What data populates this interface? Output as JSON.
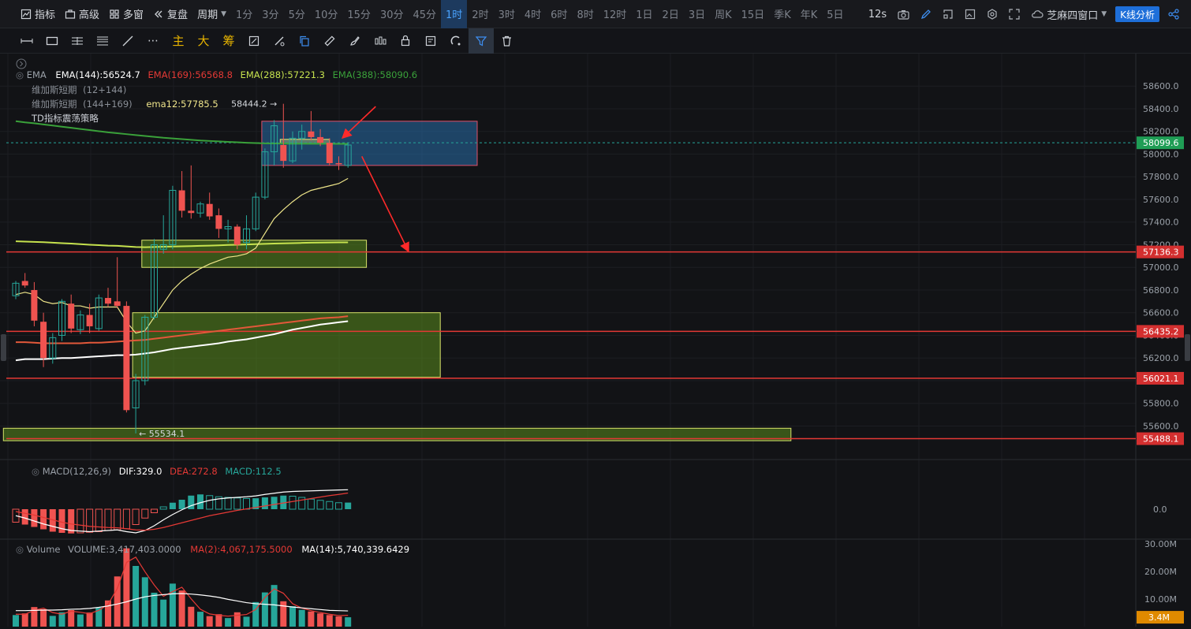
{
  "toolbar": {
    "indicators_label": "指标",
    "advanced_label": "高级",
    "multiwindow_label": "多窗",
    "replay_label": "复盘",
    "period_label": "周期",
    "periods": [
      "1分",
      "3分",
      "5分",
      "10分",
      "15分",
      "30分",
      "45分",
      "1时",
      "2时",
      "3时",
      "4时",
      "6时",
      "8时",
      "12时",
      "1日",
      "2日",
      "3日",
      "周K",
      "15日",
      "季K",
      "年K",
      "5日"
    ],
    "active_period": "1时",
    "refresh_label": "12s",
    "window_label": "芝麻四窗口",
    "kline_analysis_label": "K线分析"
  },
  "drawing_tools": {
    "main_label": "主",
    "big_label": "大",
    "chip_label": "筹"
  },
  "main_legend": {
    "name": "EMA",
    "ema144": "EMA(144):56524.7",
    "ema169": "EMA(169):56568.8",
    "ema288": "EMA(288):57221.3",
    "ema388": "EMA(388):58090.6",
    "vegas_short": "维加斯短期",
    "vegas_short_param": "(12+144)",
    "vegas_short2": "维加斯短期",
    "vegas_short2_param": "(144+169)",
    "ema12": "ema12:57785.5",
    "td_strategy": "TD指标震荡策略"
  },
  "price_axis": {
    "ticks": [
      "58600.0",
      "58400.0",
      "58200.0",
      "58000.0",
      "57800.0",
      "57600.0",
      "57400.0",
      "57200.0",
      "57000.0",
      "56800.0",
      "56600.0",
      "56400.0",
      "56200.0",
      "56000.0",
      "55800.0",
      "55600.0"
    ],
    "current_price": "58099.6",
    "levels": [
      "57136.3",
      "56435.2",
      "56021.1",
      "55488.1"
    ]
  },
  "annotations": {
    "high": "58444.2",
    "low": "55534.1"
  },
  "macd": {
    "name": "MACD(12,26,9)",
    "dif": "DIF:329.0",
    "dea": "DEA:272.8",
    "macd": "MACD:112.5",
    "axis_zero": "0.0"
  },
  "volume": {
    "name": "Volume",
    "volume": "VOLUME:3,417,403.0000",
    "ma2": "MA(2):4,067,175.5000",
    "ma14": "MA(14):5,740,339.6429",
    "ticks": [
      "30.00M",
      "20.00M",
      "10.00M"
    ],
    "current": "3.4M"
  },
  "colors": {
    "up": "#26a69a",
    "down": "#ef5350",
    "accent": "#1e6fd9",
    "level_line": "#e53935",
    "current_price": "#1f9d55",
    "current_volume": "#e08a00"
  },
  "chart_data": {
    "type": "candlestick",
    "interval": "1时",
    "ylim": [
      55450,
      58720
    ],
    "candles": [
      {
        "o": 56750,
        "h": 56880,
        "l": 56720,
        "c": 56860
      },
      {
        "o": 56880,
        "h": 56950,
        "l": 56820,
        "c": 56840
      },
      {
        "o": 56800,
        "h": 56870,
        "l": 56480,
        "c": 56530
      },
      {
        "o": 56520,
        "h": 56600,
        "l": 56120,
        "c": 56200
      },
      {
        "o": 56200,
        "h": 56420,
        "l": 56150,
        "c": 56380
      },
      {
        "o": 56400,
        "h": 56720,
        "l": 56350,
        "c": 56700
      },
      {
        "o": 56680,
        "h": 56760,
        "l": 56420,
        "c": 56460
      },
      {
        "o": 56450,
        "h": 56620,
        "l": 56410,
        "c": 56580
      },
      {
        "o": 56580,
        "h": 56680,
        "l": 56420,
        "c": 56480
      },
      {
        "o": 56460,
        "h": 56760,
        "l": 56440,
        "c": 56730
      },
      {
        "o": 56730,
        "h": 56820,
        "l": 56650,
        "c": 56680
      },
      {
        "o": 56700,
        "h": 57090,
        "l": 56640,
        "c": 56660
      },
      {
        "o": 56660,
        "h": 56700,
        "l": 55720,
        "c": 55740
      },
      {
        "o": 55760,
        "h": 56060,
        "l": 55534,
        "c": 56000
      },
      {
        "o": 56000,
        "h": 56580,
        "l": 55960,
        "c": 56560
      },
      {
        "o": 56560,
        "h": 57250,
        "l": 56540,
        "c": 57200
      },
      {
        "o": 57160,
        "h": 57460,
        "l": 57120,
        "c": 57200
      },
      {
        "o": 57200,
        "h": 57720,
        "l": 57160,
        "c": 57680
      },
      {
        "o": 57680,
        "h": 57850,
        "l": 57440,
        "c": 57500
      },
      {
        "o": 57500,
        "h": 57900,
        "l": 57430,
        "c": 57480
      },
      {
        "o": 57480,
        "h": 57580,
        "l": 57440,
        "c": 57560
      },
      {
        "o": 57560,
        "h": 57660,
        "l": 57420,
        "c": 57450
      },
      {
        "o": 57460,
        "h": 57520,
        "l": 57260,
        "c": 57340
      },
      {
        "o": 57340,
        "h": 57420,
        "l": 57220,
        "c": 57360
      },
      {
        "o": 57360,
        "h": 57380,
        "l": 57160,
        "c": 57200
      },
      {
        "o": 57220,
        "h": 57460,
        "l": 57160,
        "c": 57340
      },
      {
        "o": 57340,
        "h": 57660,
        "l": 57320,
        "c": 57620
      },
      {
        "o": 57620,
        "h": 58050,
        "l": 57600,
        "c": 58020
      },
      {
        "o": 58020,
        "h": 58300,
        "l": 57900,
        "c": 58250
      },
      {
        "o": 58080,
        "h": 58444,
        "l": 57880,
        "c": 57940
      },
      {
        "o": 57940,
        "h": 58200,
        "l": 57920,
        "c": 58140
      },
      {
        "o": 58140,
        "h": 58260,
        "l": 58040,
        "c": 58200
      },
      {
        "o": 58200,
        "h": 58380,
        "l": 58120,
        "c": 58150
      },
      {
        "o": 58150,
        "h": 58220,
        "l": 58070,
        "c": 58100
      },
      {
        "o": 58100,
        "h": 58140,
        "l": 57900,
        "c": 57920
      },
      {
        "o": 57920,
        "h": 57980,
        "l": 57860,
        "c": 57910
      },
      {
        "o": 57900,
        "h": 58100,
        "l": 57880,
        "c": 58080
      }
    ],
    "ema12": [
      56760,
      56780,
      56760,
      56700,
      56680,
      56690,
      56660,
      56660,
      56640,
      56650,
      56650,
      56650,
      56520,
      56420,
      56440,
      56560,
      56680,
      56800,
      56880,
      56940,
      56990,
      57030,
      57060,
      57090,
      57100,
      57120,
      57170,
      57300,
      57430,
      57510,
      57580,
      57640,
      57680,
      57700,
      57720,
      57740,
      57785
    ],
    "ema144": [
      56180,
      56190,
      56190,
      56190,
      56195,
      56200,
      56200,
      56205,
      56210,
      56215,
      56220,
      56225,
      56225,
      56230,
      56240,
      56250,
      56265,
      56280,
      56290,
      56300,
      56310,
      56320,
      56330,
      56345,
      56355,
      56365,
      56380,
      56395,
      56410,
      56430,
      56450,
      56465,
      56480,
      56495,
      56505,
      56515,
      56525
    ],
    "ema169": [
      56340,
      56340,
      56335,
      56330,
      56330,
      56330,
      56330,
      56330,
      56335,
      56335,
      56340,
      56345,
      56350,
      56355,
      56360,
      56370,
      56380,
      56390,
      56400,
      56410,
      56420,
      56430,
      56440,
      56450,
      56460,
      56470,
      56480,
      56490,
      56500,
      56510,
      56520,
      56530,
      56540,
      56550,
      56555,
      56560,
      56569
    ],
    "ema288": [
      57230,
      57228,
      57225,
      57222,
      57218,
      57214,
      57210,
      57205,
      57200,
      57196,
      57192,
      57190,
      57185,
      57180,
      57178,
      57180,
      57182,
      57184,
      57186,
      57188,
      57190,
      57192,
      57195,
      57198,
      57200,
      57202,
      57205,
      57208,
      57210,
      57212,
      57214,
      57216,
      57218,
      57219,
      57220,
      57221,
      57221
    ],
    "ema388": [
      58290,
      58280,
      58272,
      58262,
      58252,
      58242,
      58232,
      58222,
      58212,
      58202,
      58192,
      58184,
      58176,
      58168,
      58160,
      58152,
      58144,
      58138,
      58132,
      58126,
      58120,
      58116,
      58112,
      58108,
      58104,
      58100,
      58097,
      58095,
      58094,
      58093,
      58092,
      58092,
      58091,
      58091,
      58091,
      58090,
      58090
    ],
    "zones": [
      {
        "top": 58290,
        "bottom": 57900,
        "from": 27,
        "to": 50,
        "kind": "blue"
      },
      {
        "top": 58130,
        "bottom": 58090,
        "from": 29,
        "to": 34,
        "kind": "yellow"
      },
      {
        "top": 57240,
        "bottom": 57000,
        "from": 14,
        "to": 38,
        "kind": "green"
      },
      {
        "top": 56600,
        "bottom": 56030,
        "from": 13,
        "to": 46,
        "kind": "green"
      },
      {
        "top": 55580,
        "bottom": 55470,
        "from": -1,
        "to": 84,
        "kind": "green"
      }
    ],
    "levels": [
      57136.3,
      56435.2,
      56021.1,
      55488.1
    ],
    "current_price": 58099.6,
    "macd_hist": [
      -220,
      -260,
      -300,
      -340,
      -380,
      -400,
      -410,
      -400,
      -390,
      -380,
      -360,
      -350,
      -330,
      -260,
      -150,
      -60,
      40,
      110,
      160,
      230,
      250,
      230,
      210,
      200,
      190,
      180,
      185,
      200,
      210,
      230,
      220,
      200,
      170,
      150,
      130,
      110,
      112
    ],
    "macd_dif": [
      -110,
      -150,
      -200,
      -250,
      -290,
      -330,
      -360,
      -370,
      -380,
      -370,
      -360,
      -350,
      -380,
      -400,
      -360,
      -280,
      -180,
      -90,
      -10,
      60,
      110,
      150,
      175,
      190,
      200,
      210,
      225,
      250,
      270,
      290,
      300,
      305,
      310,
      315,
      320,
      325,
      329
    ],
    "macd_dea": [
      -40,
      -70,
      -100,
      -140,
      -180,
      -220,
      -250,
      -270,
      -290,
      -300,
      -310,
      -315,
      -330,
      -350,
      -355,
      -340,
      -310,
      -270,
      -230,
      -190,
      -150,
      -110,
      -80,
      -50,
      -20,
      5,
      30,
      55,
      80,
      105,
      130,
      155,
      180,
      205,
      230,
      250,
      273
    ],
    "volume_vals": [
      4.2,
      4.8,
      7.1,
      6.3,
      3.9,
      5.2,
      6.0,
      4.4,
      5.1,
      6.8,
      9.5,
      18.2,
      28.4,
      22.0,
      17.9,
      12.3,
      9.8,
      15.6,
      13.1,
      7.2,
      5.4,
      3.8,
      4.5,
      3.1,
      5.2,
      3.6,
      8.9,
      12.4,
      15.1,
      9.2,
      7.4,
      6.1,
      5.5,
      4.8,
      4.2,
      3.7,
      3.4
    ],
    "volume_ma2": [
      4.5,
      4.5,
      5.9,
      6.7,
      5.1,
      4.5,
      5.6,
      5.2,
      4.7,
      5.9,
      8.1,
      13.8,
      23.3,
      25.2,
      19.9,
      15.1,
      11.0,
      12.7,
      14.3,
      10.1,
      6.3,
      4.6,
      4.1,
      3.8,
      4.1,
      4.4,
      6.2,
      10.6,
      13.7,
      12.1,
      8.3,
      6.7,
      5.8,
      5.1,
      4.5,
      4.0,
      4.1
    ],
    "volume_ma14": [
      5.8,
      5.8,
      5.9,
      6.0,
      6.0,
      6.1,
      6.3,
      6.4,
      6.6,
      7.0,
      7.5,
      8.2,
      9.0,
      10.0,
      10.8,
      11.3,
      11.6,
      11.9,
      12.0,
      11.8,
      11.5,
      11.1,
      10.6,
      9.9,
      9.3,
      8.7,
      8.3,
      8.1,
      7.9,
      7.5,
      7.1,
      6.8,
      6.5,
      6.2,
      5.9,
      5.8,
      5.7
    ]
  }
}
